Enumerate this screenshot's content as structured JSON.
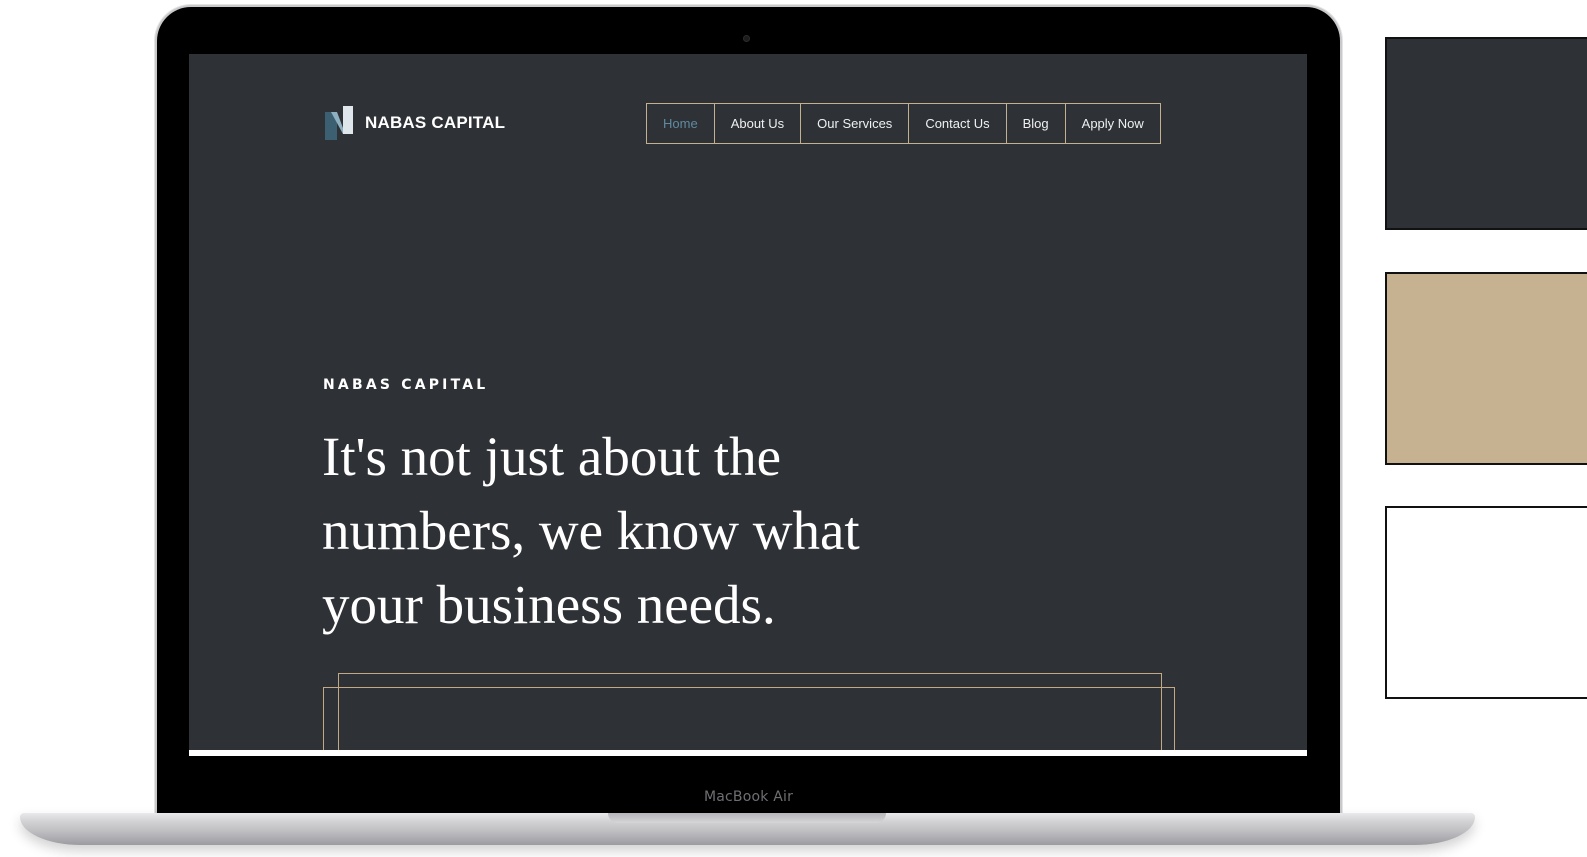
{
  "site": {
    "logo_text": "NABAS CAPITAL",
    "nav": [
      {
        "label": "Home",
        "active": true
      },
      {
        "label": "About Us",
        "active": false
      },
      {
        "label": "Our Services",
        "active": false
      },
      {
        "label": "Contact Us",
        "active": false
      },
      {
        "label": "Blog",
        "active": false
      },
      {
        "label": "Apply Now",
        "active": false
      }
    ],
    "hero": {
      "eyebrow": "NABAS CAPITAL",
      "headline_lines": [
        "It's not just about the",
        "numbers, we know what",
        "your business needs."
      ]
    }
  },
  "device": {
    "label": "MacBook Air"
  },
  "palette": [
    {
      "name": "charcoal",
      "hex": "#2e3135"
    },
    {
      "name": "tan",
      "hex": "#c6b291"
    },
    {
      "name": "white",
      "hex": "#ffffff"
    }
  ],
  "colors": {
    "accent_gold": "#c2a883",
    "active_nav": "#5f8aa0",
    "logo_dark": "#3d5f72",
    "logo_light": "#dfe7ec"
  }
}
